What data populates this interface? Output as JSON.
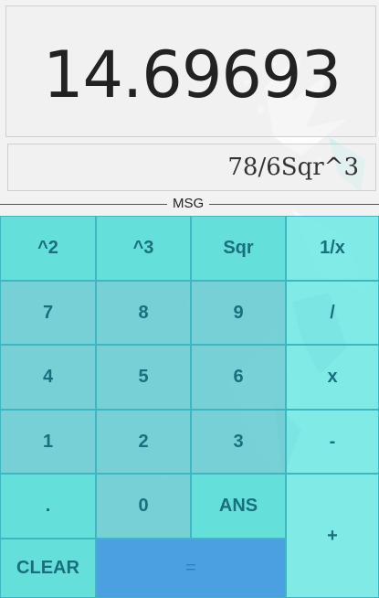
{
  "display": {
    "result": "14.69693",
    "expression": "78/6Sqr^3",
    "message_label": "MSG"
  },
  "keys": {
    "square": "^2",
    "cube": "^3",
    "sqrt": "Sqr",
    "reciprocal": "1/x",
    "seven": "7",
    "eight": "8",
    "nine": "9",
    "divide": "/",
    "four": "4",
    "five": "5",
    "six": "6",
    "multiply": "x",
    "one": "1",
    "two": "2",
    "three": "3",
    "minus": "-",
    "decimal": ".",
    "zero": "0",
    "answer": "ANS",
    "plus": "+",
    "clear": "CLEAR",
    "equals": "="
  },
  "colors": {
    "key_fill": "#58ddd8",
    "key_text": "#1a6f7e",
    "equals_fill": "#4aa0e0"
  }
}
